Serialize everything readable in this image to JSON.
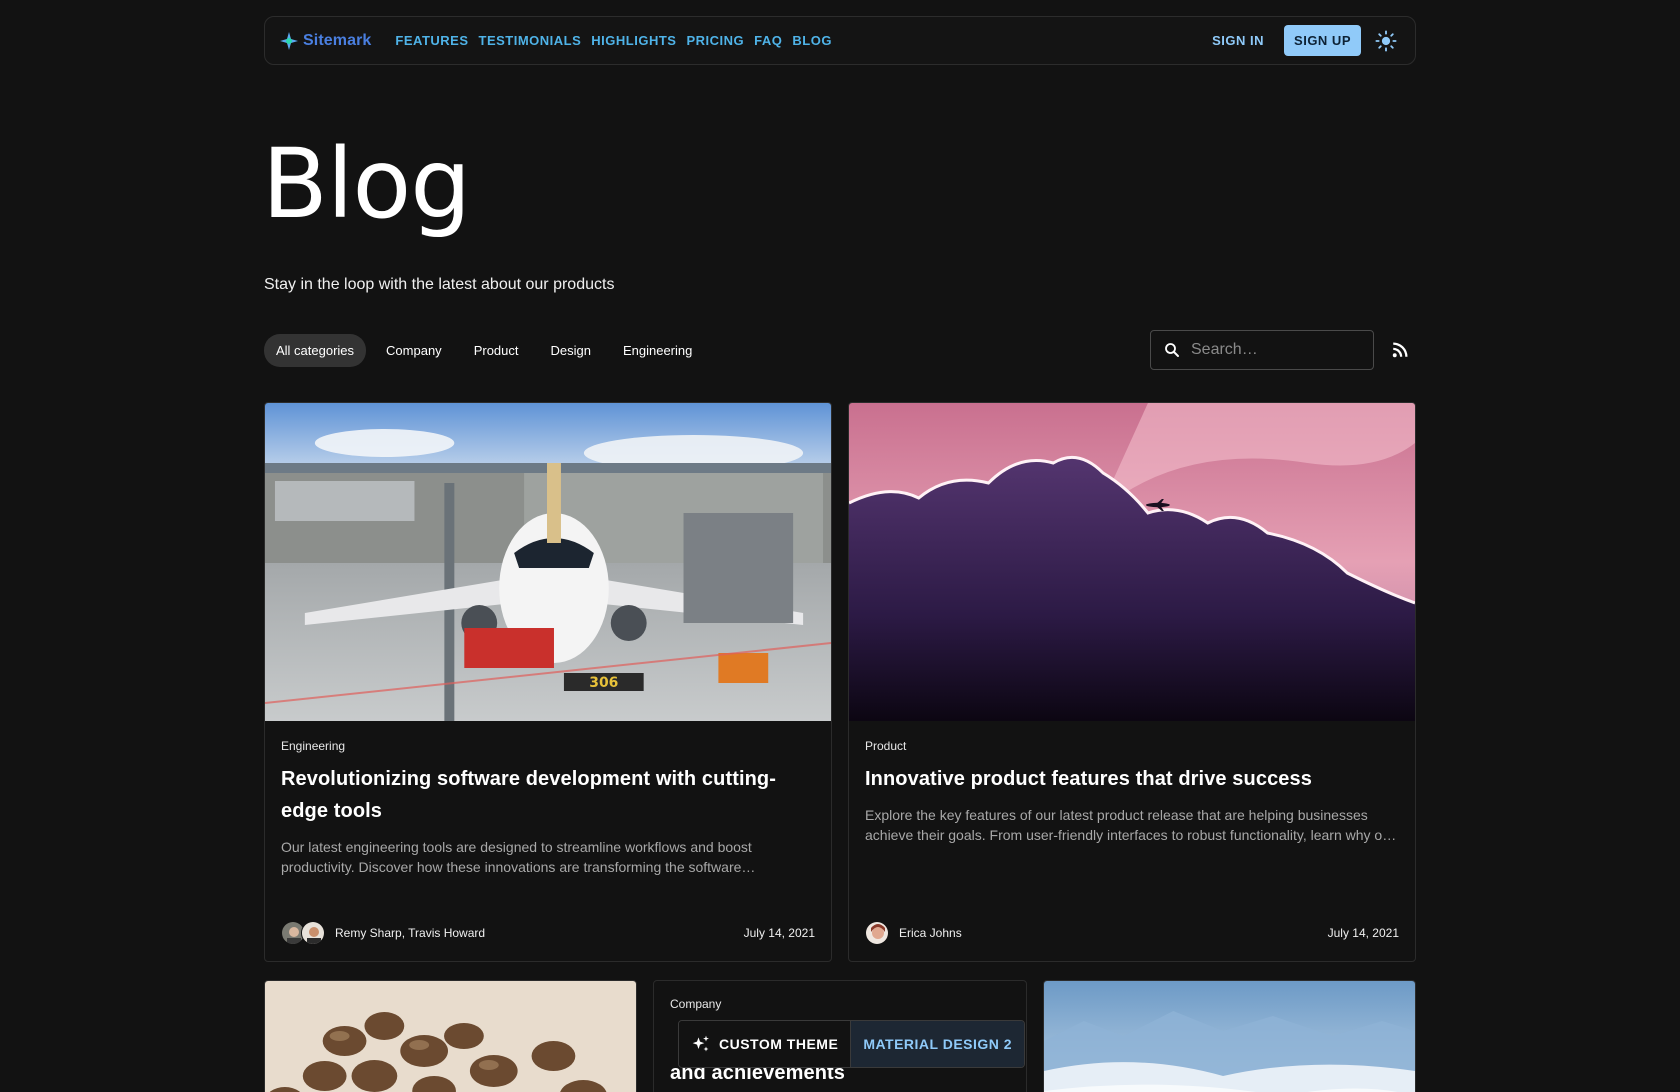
{
  "nav": {
    "logo_text": "Sitemark",
    "links": [
      "FEATURES",
      "TESTIMONIALS",
      "HIGHLIGHTS",
      "PRICING",
      "FAQ",
      "BLOG"
    ],
    "sign_in": "SIGN IN",
    "sign_up": "SIGN UP"
  },
  "hero": {
    "title": "Blog",
    "subtitle": "Stay in the loop with the latest about our products"
  },
  "filters": {
    "chips": [
      "All categories",
      "Company",
      "Product",
      "Design",
      "Engineering"
    ],
    "active": "All categories",
    "search_placeholder": "Search…"
  },
  "cards": [
    {
      "category": "Engineering",
      "title": "Revolutionizing software development with cutting-edge tools",
      "description": "Our latest engineering tools are designed to streamline workflows and boost productivity. Discover how these innovations are transforming the software development landscape.",
      "authors": "Remy Sharp, Travis Howard",
      "date": "July 14, 2021",
      "image": "airplane-at-gate"
    },
    {
      "category": "Product",
      "title": "Innovative product features that drive success",
      "description": "Explore the key features of our latest product release that are helping businesses achieve their goals. From user-friendly interfaces to robust functionality, learn why our product stands out.",
      "authors": "Erica Johns",
      "date": "July 14, 2021",
      "image": "plane-over-clouds"
    },
    {
      "image": "coffee-beans"
    },
    {
      "category": "Company",
      "title_partial": "and achievements"
    },
    {
      "image": "mountains-in-clouds"
    }
  ],
  "theme_switcher": {
    "custom": "CUSTOM THEME",
    "md2": "MATERIAL DESIGN 2"
  },
  "colors": {
    "background": "#121212",
    "accent": "#90caf9",
    "nav_link": "#4fb3e8",
    "logo": "#4a7fe0"
  }
}
